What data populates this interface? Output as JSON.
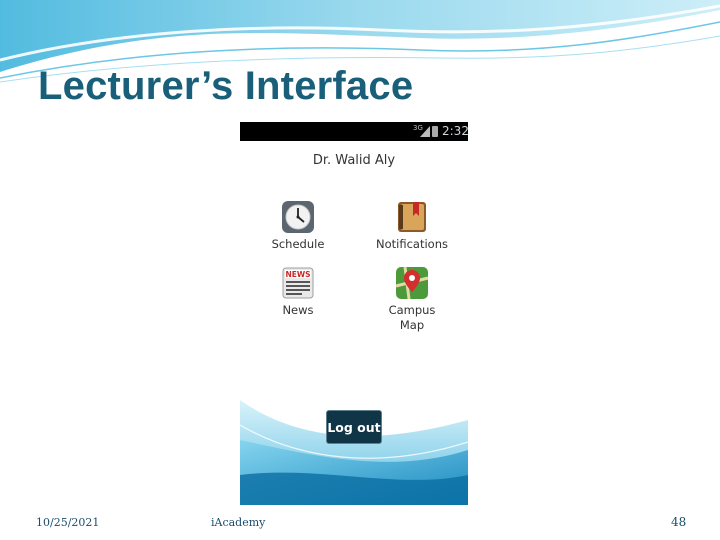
{
  "slide": {
    "title": "Lecturer’s Interface",
    "footer_date": "10/25/2021",
    "footer_center": "iAcademy",
    "page_number": "48"
  },
  "phone": {
    "status_bar": {
      "network": "3G",
      "time": "2:32"
    },
    "user_name": "Dr. Walid Aly",
    "tiles": [
      {
        "label": "Schedule",
        "icon": "clock-icon"
      },
      {
        "label": "Notifications",
        "icon": "notebook-icon"
      },
      {
        "label": "News",
        "icon": "newspaper-icon"
      },
      {
        "label": "Campus Map",
        "icon": "map-pin-icon"
      }
    ],
    "news_icon_text": "NEWS",
    "logout_label": "Log out"
  },
  "colors": {
    "title": "#1a5f7a",
    "logout_button": "#0f3547",
    "wave": "#29a9d6"
  }
}
